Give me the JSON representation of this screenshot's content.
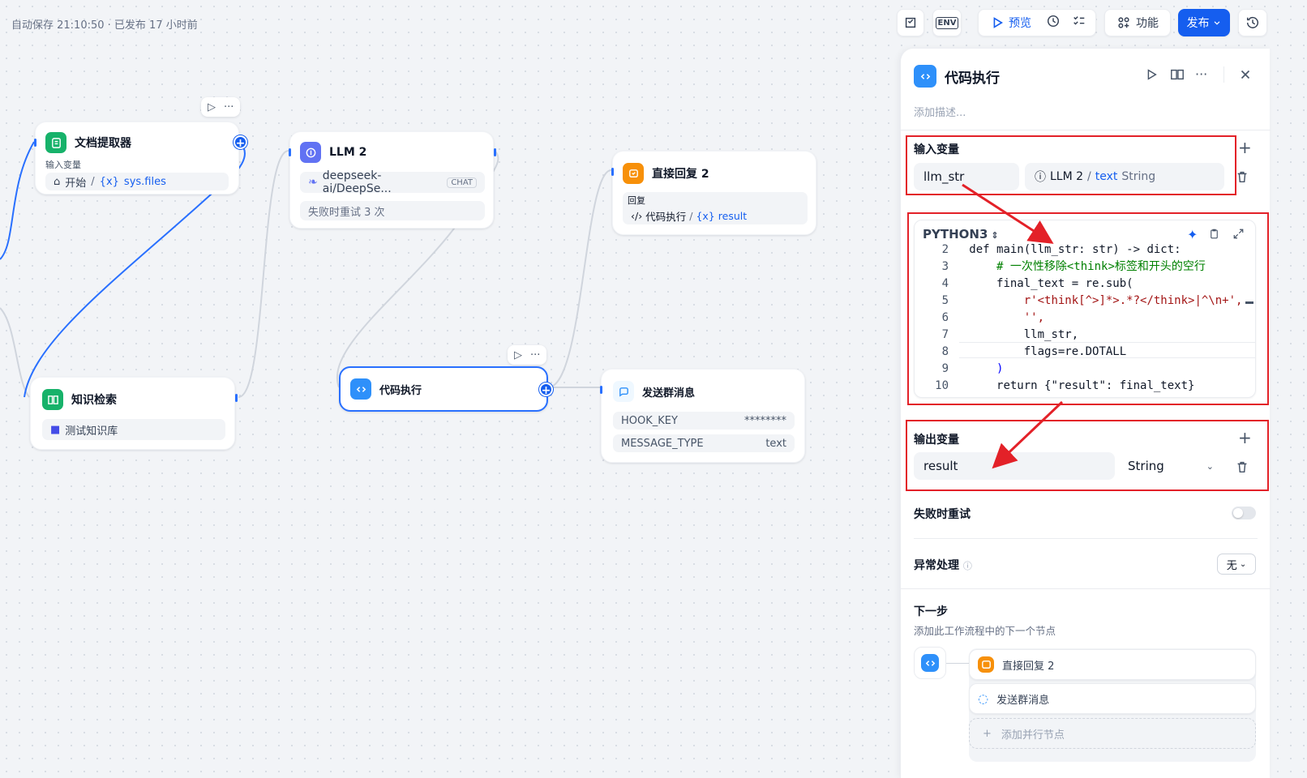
{
  "topbar": {
    "autosave": "自动保存 21:10:50 · 已发布 17 小时前",
    "env_label": "ENV",
    "preview": "预览",
    "features": "功能",
    "publish": "发布"
  },
  "nodes": {
    "doc_extractor": {
      "title": "文档提取器",
      "input_label": "输入变量",
      "source": "开始",
      "var": "sys.files"
    },
    "llm2": {
      "title": "LLM 2",
      "model": "deepseek-ai/DeepSe...",
      "mode": "CHAT",
      "retry": "失败时重试 3 次"
    },
    "reply2": {
      "title": "直接回复 2",
      "reply_label": "回复",
      "source": "代码执行",
      "var": "result"
    },
    "knowledge": {
      "title": "知识检索",
      "kb": "测试知识库"
    },
    "code": {
      "title": "代码执行"
    },
    "send_msg": {
      "title": "发送群消息",
      "rows": [
        {
          "key": "HOOK_KEY",
          "value": "********"
        },
        {
          "key": "MESSAGE_TYPE",
          "value": "text"
        }
      ]
    }
  },
  "panel": {
    "title": "代码执行",
    "desc_placeholder": "添加描述...",
    "input_section": "输入变量",
    "input_var_name": "llm_str",
    "input_var_source": "LLM 2",
    "input_var_field": "text",
    "input_var_type": "String",
    "language": "PYTHON3",
    "code_lines": [
      {
        "n": "2",
        "text": "def main(llm_str: str) -> dict:"
      },
      {
        "n": "3",
        "text": "    # 一次性移除<think>标签和开头的空行"
      },
      {
        "n": "4",
        "text": "    final_text = re.sub("
      },
      {
        "n": "5",
        "text": "        r'<think[^>]*>.*?</think>|^\\n+',"
      },
      {
        "n": "6",
        "text": "        '',"
      },
      {
        "n": "7",
        "text": "        llm_str,"
      },
      {
        "n": "8",
        "text": "        flags=re.DOTALL"
      },
      {
        "n": "9",
        "text": "    )"
      },
      {
        "n": "10",
        "text": "    return {\"result\": final_text}"
      }
    ],
    "output_section": "输出变量",
    "output_var_name": "result",
    "output_var_type": "String",
    "retry_label": "失败时重试",
    "error_label": "异常处理",
    "error_value": "无",
    "next_title": "下一步",
    "next_desc": "添加此工作流程中的下一个节点",
    "next_items": [
      "直接回复 2",
      "发送群消息"
    ],
    "add_parallel": "添加并行节点"
  },
  "colors": {
    "accent": "#155eef",
    "annotation_red": "#e32128",
    "green_node": "#17b26a",
    "purple_node": "#6172f3",
    "orange_node": "#f79009"
  }
}
